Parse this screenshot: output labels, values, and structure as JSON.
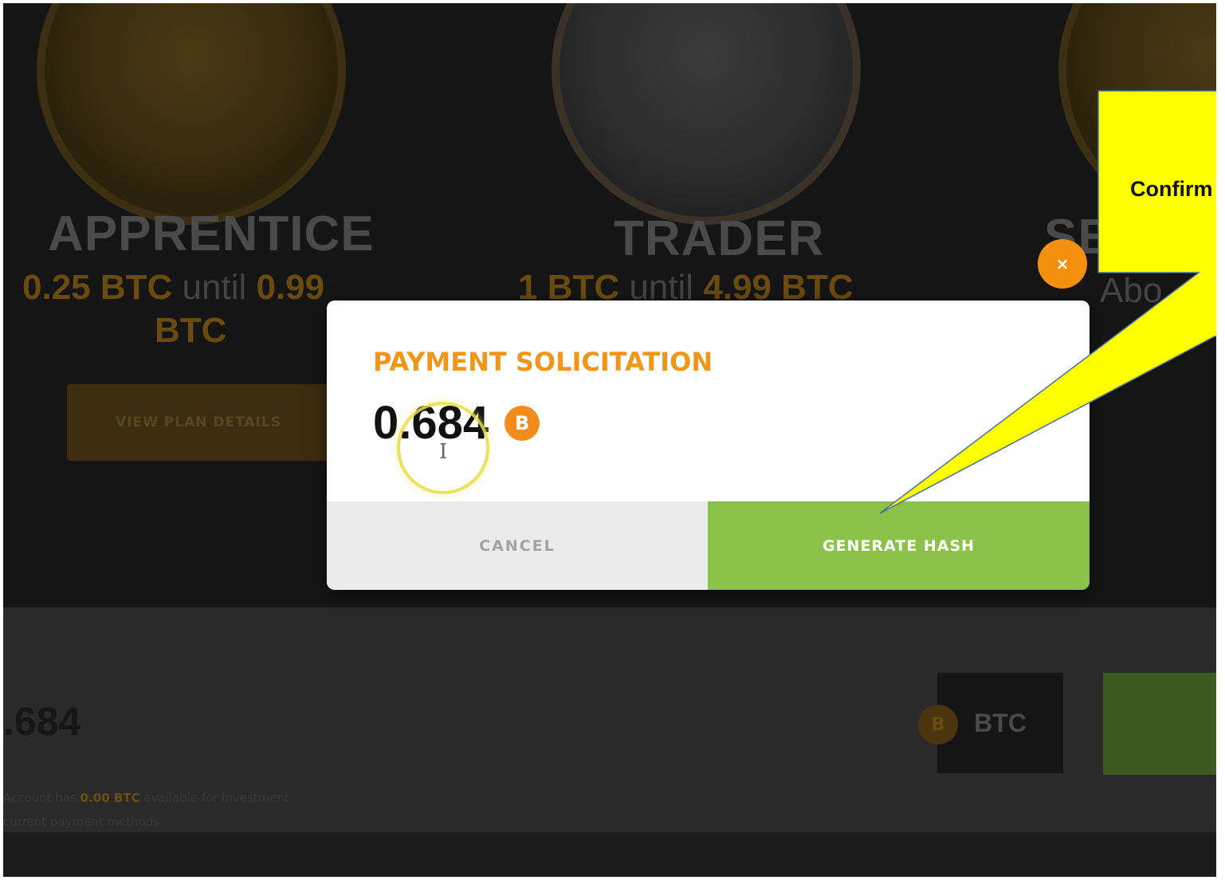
{
  "background_page": {
    "plans": [
      {
        "name": "APPRENTICE",
        "range_min": "0.25 BTC",
        "range_until": "until",
        "range_max": "0.99",
        "range_max_unit": "BTC",
        "button_label": "VIEW PLAN DETAILS"
      },
      {
        "name": "TRADER",
        "range_min": "1 BTC",
        "range_until": "until",
        "range_max": "4.99 BTC"
      },
      {
        "name": "SE",
        "range_text": "Abo"
      }
    ],
    "amount": ".684",
    "balance_note_prefix": "Account has",
    "balance_note_value": "0.00 BTC",
    "balance_note_suffix": "available for investment",
    "balance_note_line2": "current payment methods",
    "currency_chip": "BTC",
    "btc_icon_glyph": "B"
  },
  "modal": {
    "title": "PAYMENT SOLICITATION",
    "amount": "0.684",
    "currency_icon": "bitcoin-icon",
    "currency_glyph": "B",
    "cancel_label": "CANCEL",
    "generate_label": "GENERATE HASH",
    "close_glyph": "×"
  },
  "cursor": {
    "text_cursor_glyph": "I"
  },
  "callout": {
    "text": "Confirm"
  },
  "colors": {
    "accent_orange": "#f0961a",
    "generate_green": "#8bc34a",
    "callout_yellow": "#ffff00"
  }
}
